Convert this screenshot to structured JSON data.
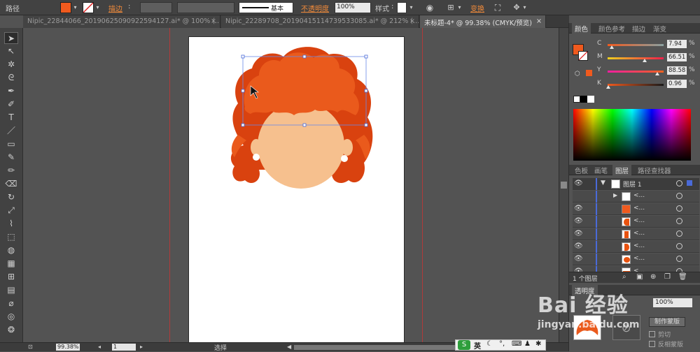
{
  "control_bar": {
    "mode_label": "路径",
    "stroke_label": "描边",
    "stroke_style": "基本",
    "opacity_label": "不透明度",
    "opacity_value": "100%",
    "style_label": "样式",
    "transform_label": "变换",
    "fill_color": "#f05a1e"
  },
  "tabs": [
    {
      "label": "Nipic_22844066_20190625090922594127.ai* @ 100% (...",
      "close": "×"
    },
    {
      "label": "Nipic_22289708_20190415114739533085.ai* @ 212% (...",
      "close": "×"
    },
    {
      "label": "未标题-4* @ 99.38% (CMYK/预览)",
      "close": "×"
    }
  ],
  "status_bar": {
    "zoom": "99.38%",
    "page": "1",
    "tool": "选择"
  },
  "color_panel": {
    "tabs": [
      "颜色",
      "颜色参考",
      "描边",
      "渐变"
    ],
    "channels": [
      {
        "name": "C",
        "value": "7.94",
        "unit": "%",
        "level": 0.08
      },
      {
        "name": "M",
        "value": "66.51",
        "unit": "%",
        "level": 0.665
      },
      {
        "name": "Y",
        "value": "88.58",
        "unit": "%",
        "level": 0.886
      },
      {
        "name": "K",
        "value": "0.96",
        "unit": "%",
        "level": 0.01
      }
    ]
  },
  "layers_panel": {
    "tabs": [
      "色板",
      "画笔",
      "图层",
      "路径查找器"
    ],
    "layer_name": "图层 1",
    "sublayer_name": "<...",
    "count_label": "1 个图层"
  },
  "transparency_panel": {
    "tab_label": "透明度",
    "opacity_value": "100%",
    "make_mask_button": "制作蒙版",
    "clip_label": "剪切",
    "invert_label": "反相蒙版"
  },
  "watermark": {
    "brand": "Bai 经验",
    "url": "jingyan.baidu.com"
  },
  "taskbar": {
    "ime_label": "英"
  }
}
